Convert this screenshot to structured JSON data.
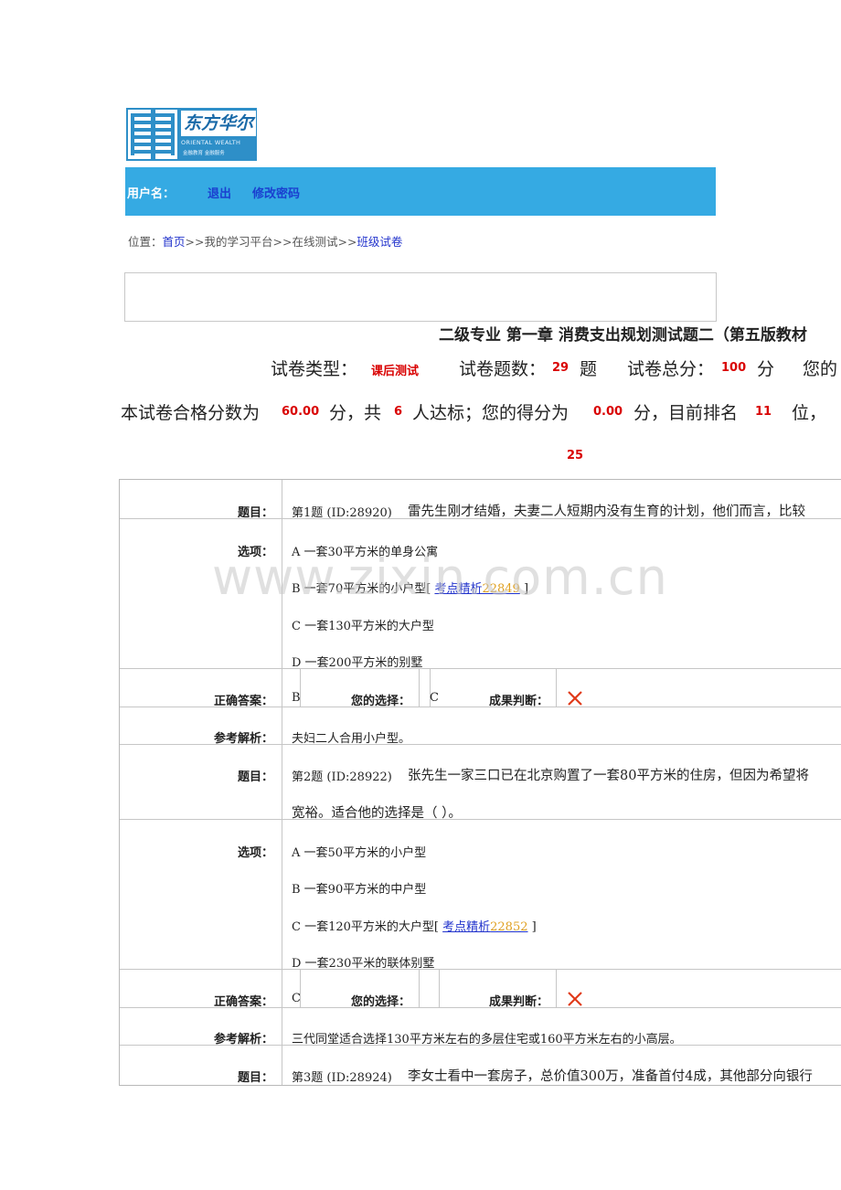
{
  "logo": {
    "brand_cn": "东方华尔",
    "brand_en": "ORIENTAL WEALTH",
    "brand_tag": "金融教育    金融服务"
  },
  "topbar": {
    "user_label": "用户名：",
    "logout": "退出",
    "change_password": "修改密码",
    "background_color": "#35aae3"
  },
  "breadcrumb": {
    "prefix": "位置：",
    "home": "首页",
    "sep1": ">>",
    "platform": "我的学习平台",
    "sep2": ">>",
    "online_test": "在线测试",
    "sep3": ">>",
    "class_paper": "班级试卷"
  },
  "paper": {
    "title": "二级专业 第一章 消费支出规划测试题二（第五版教材",
    "type_label": "试卷类型：",
    "type_value": "课后测试",
    "count_label": "试卷题数：",
    "count_value": "29",
    "count_unit": "题",
    "total_label": "试卷总分：",
    "total_value": "100",
    "total_unit": "分",
    "yours_label": "您的",
    "pass_prefix": "本试卷合格分数为",
    "pass_value": "60.00",
    "pass_mid": "分，共",
    "pass_count": "6",
    "pass_mid2": "人达标；您的得分为",
    "score_value": "0.00",
    "score_mid": "分，目前排名",
    "rank_value": "11",
    "rank_unit": "位，",
    "total_people": "25"
  },
  "labels": {
    "question": "题目：",
    "options": "选项：",
    "correct": "正确答案：",
    "your_choice": "您的选择：",
    "judgement": "成果判断：",
    "analysis": "参考解析："
  },
  "questions": [
    {
      "header": "第1题    (ID:28920)",
      "text": "雷先生刚才结婚，夫妻二人短期内没有生育的计划，他们而言，比较",
      "options": [
        "A   一套30平方米的单身公寓",
        "B   一套70平方米的小户型",
        "C   一套130平方米的大户型",
        "D   一套200平方米的别墅"
      ],
      "keypoint_label": "考点精析",
      "keypoint_num": "22849",
      "correct": "B",
      "choice": "C",
      "analysis": "夫妇二人合用小户型。"
    },
    {
      "header": "第2题    (ID:28922)",
      "text": "张先生一家三口已在北京购置了一套80平方米的住房，但因为希望将",
      "text2": "宽裕。适合他的选择是（  ）。",
      "options": [
        "A   一套50平方米的小户型",
        "B   一套90平方米的中户型",
        "C   一套120平方米的大户型",
        "D   一套230平米的联体别墅"
      ],
      "keypoint_label": "考点精析",
      "keypoint_num": "22852",
      "correct": "C",
      "choice": "",
      "analysis": "三代同堂适合选择130平方米左右的多层住宅或160平方米左右的小高层。"
    },
    {
      "header": "第3题    (ID:28924)",
      "text": "李女士看中一套房子，总价值300万，准备首付4成，其他部分向银行"
    }
  ],
  "watermark": "www.zixin.com.cn"
}
